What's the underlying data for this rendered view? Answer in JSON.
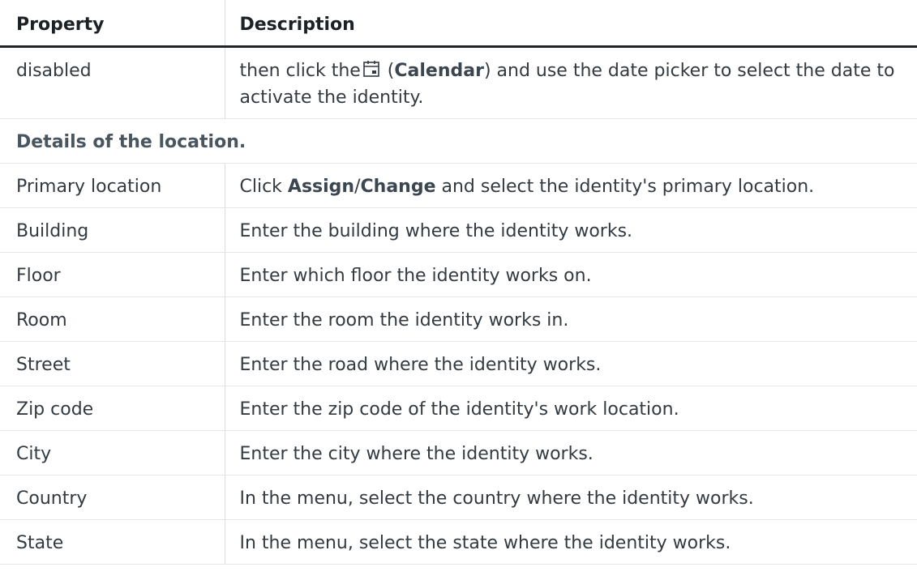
{
  "table": {
    "headers": {
      "property": "Property",
      "description": "Description"
    },
    "disabled_row": {
      "property": "disabled",
      "desc_before": "then click the",
      "icon": "calendar-icon",
      "desc_paren_open": " (",
      "desc_bold": "Calendar",
      "desc_after": ") and use the date picker to select the date to activate the identity."
    },
    "section": {
      "label": "Details of the location."
    },
    "primary_location": {
      "property": "Primary location",
      "desc_before": "Click ",
      "desc_bold_1": "Assign",
      "desc_slash": "/",
      "desc_bold_2": "Change",
      "desc_after": " and select the identity's primary location."
    },
    "rows": [
      {
        "property": "Building",
        "description": "Enter the building where the identity works."
      },
      {
        "property": "Floor",
        "description": "Enter which floor the identity works on."
      },
      {
        "property": "Room",
        "description": "Enter the room the identity works in."
      },
      {
        "property": "Street",
        "description": "Enter the road where the identity works."
      },
      {
        "property": "Zip code",
        "description": "Enter the zip code of the identity's work location."
      },
      {
        "property": "City",
        "description": "Enter the city where the identity works."
      },
      {
        "property": "Country",
        "description": "In the menu, select the country where the identity works."
      },
      {
        "property": "State",
        "description": "In the menu, select the state where the identity works."
      }
    ]
  }
}
